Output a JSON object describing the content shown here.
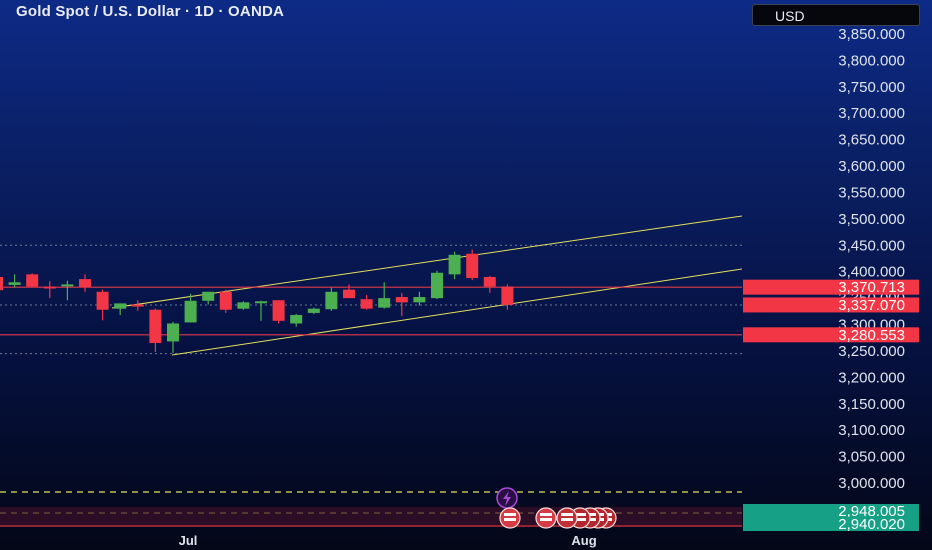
{
  "header": {
    "title": "Gold Spot / U.S. Dollar · 1D · OANDA",
    "currency": "USD"
  },
  "colors": {
    "up": "#4caf50",
    "down": "#f23645",
    "channel": "#e6e05a",
    "level_line": "#e0394a",
    "dotted": "#8a93a8",
    "lower_tag": "#16a085",
    "indicator_dashed": "#e6e05a"
  },
  "chart_data": {
    "type": "candlestick",
    "y_axis_ticks": [
      "3,850.000",
      "3,800.000",
      "3,750.000",
      "3,700.000",
      "3,650.000",
      "3,600.000",
      "3,550.000",
      "3,500.000",
      "3,450.000",
      "3,400.000",
      "3,350.000",
      "3,300.000",
      "3,250.000",
      "3,200.000",
      "3,150.000",
      "3,100.000",
      "3,050.000",
      "3,000.000"
    ],
    "ylim": [
      2990,
      3870
    ],
    "x_axis_labels": [
      "Jul",
      "Aug"
    ],
    "candles": [
      {
        "o": 3390,
        "h": 3405,
        "l": 3365,
        "c": 3365
      },
      {
        "o": 3375,
        "h": 3395,
        "l": 3370,
        "c": 3380
      },
      {
        "o": 3395,
        "h": 3397,
        "l": 3370,
        "c": 3372
      },
      {
        "o": 3372,
        "h": 3382,
        "l": 3350,
        "c": 3370
      },
      {
        "o": 3375,
        "h": 3383,
        "l": 3346,
        "c": 3376
      },
      {
        "o": 3386,
        "h": 3395,
        "l": 3362,
        "c": 3371
      },
      {
        "o": 3362,
        "h": 3366,
        "l": 3308,
        "c": 3328
      },
      {
        "o": 3330,
        "h": 3340,
        "l": 3318,
        "c": 3340
      },
      {
        "o": 3338,
        "h": 3346,
        "l": 3326,
        "c": 3334
      },
      {
        "o": 3328,
        "h": 3330,
        "l": 3248,
        "c": 3265
      },
      {
        "o": 3268,
        "h": 3305,
        "l": 3246,
        "c": 3302
      },
      {
        "o": 3304,
        "h": 3358,
        "l": 3304,
        "c": 3345
      },
      {
        "o": 3345,
        "h": 3362,
        "l": 3338,
        "c": 3362
      },
      {
        "o": 3362,
        "h": 3366,
        "l": 3322,
        "c": 3328
      },
      {
        "o": 3330,
        "h": 3344,
        "l": 3328,
        "c": 3342
      },
      {
        "o": 3344,
        "h": 3345,
        "l": 3307,
        "c": 3344
      },
      {
        "o": 3346,
        "h": 3346,
        "l": 3302,
        "c": 3307
      },
      {
        "o": 3302,
        "h": 3320,
        "l": 3296,
        "c": 3318
      },
      {
        "o": 3322,
        "h": 3332,
        "l": 3320,
        "c": 3330
      },
      {
        "o": 3329,
        "h": 3370,
        "l": 3326,
        "c": 3362
      },
      {
        "o": 3366,
        "h": 3376,
        "l": 3354,
        "c": 3350
      },
      {
        "o": 3348,
        "h": 3356,
        "l": 3328,
        "c": 3330
      },
      {
        "o": 3332,
        "h": 3380,
        "l": 3330,
        "c": 3350
      },
      {
        "o": 3352,
        "h": 3360,
        "l": 3316,
        "c": 3342
      },
      {
        "o": 3342,
        "h": 3362,
        "l": 3336,
        "c": 3352
      },
      {
        "o": 3350,
        "h": 3402,
        "l": 3348,
        "c": 3398
      },
      {
        "o": 3395,
        "h": 3438,
        "l": 3386,
        "c": 3432
      },
      {
        "o": 3434,
        "h": 3442,
        "l": 3384,
        "c": 3388
      },
      {
        "o": 3390,
        "h": 3392,
        "l": 3360,
        "c": 3372
      },
      {
        "o": 3372,
        "h": 3376,
        "l": 3328,
        "c": 3337
      }
    ],
    "price_tags": [
      {
        "label": "3,370.713",
        "value": 3370.713
      },
      {
        "label": "3,337.070",
        "value": 3337.07
      },
      {
        "label": "3,280.553",
        "value": 3280.553
      }
    ],
    "lower_tags": [
      "2,948.005",
      "2,940.020"
    ]
  }
}
